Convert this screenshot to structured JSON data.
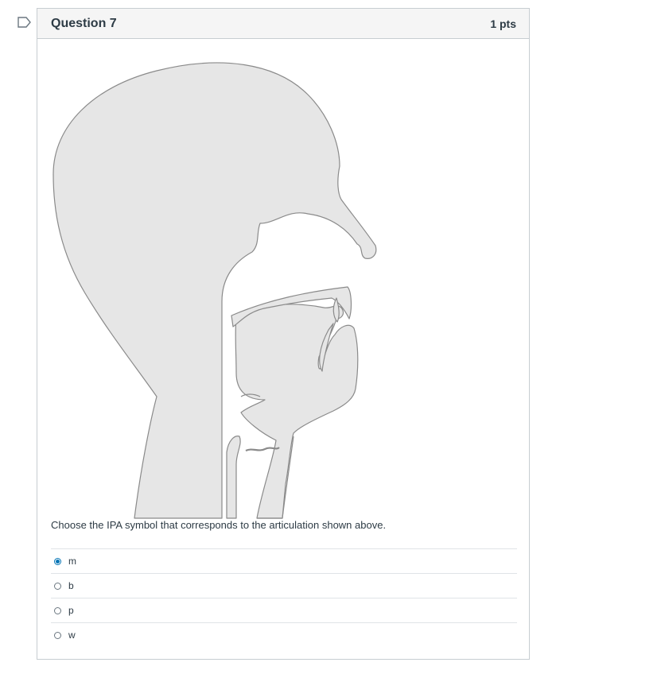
{
  "question": {
    "title": "Question 7",
    "points": "1 pts",
    "prompt": "Choose the IPA symbol that corresponds to the articulation shown above."
  },
  "answers": [
    {
      "label": "m",
      "selected": true
    },
    {
      "label": "b",
      "selected": false
    },
    {
      "label": "p",
      "selected": false
    },
    {
      "label": "w",
      "selected": false
    }
  ],
  "colors": {
    "tissue_fill": "#e6e6e6",
    "outline": "#8a8a8a",
    "accent": "#0374b5",
    "border": "#c7cdd1"
  },
  "icons": {
    "flag": "bookmark-flag-icon"
  }
}
